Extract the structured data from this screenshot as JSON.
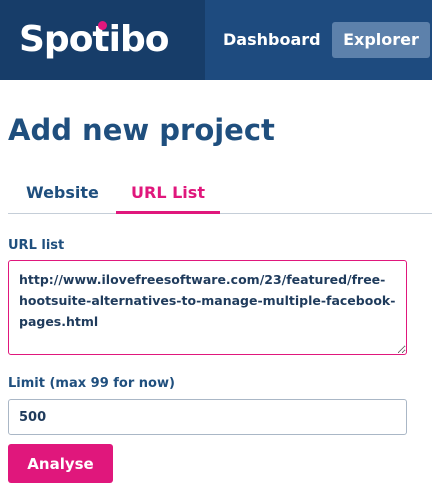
{
  "header": {
    "logo_text": "Spotibo",
    "nav": {
      "dashboard_label": "Dashboard",
      "explorer_label": "Explorer"
    }
  },
  "main": {
    "title": "Add new project",
    "tabs": [
      {
        "label": "Website",
        "active": false
      },
      {
        "label": "URL List",
        "active": true
      }
    ],
    "url_list": {
      "label": "URL list",
      "value": "http://www.ilovefreesoftware.com/23/featured/free-hootsuite-alternatives-to-manage-multiple-facebook-pages.html"
    },
    "limit": {
      "label": "Limit (max 99 for now)",
      "value": "500"
    },
    "analyse_button_label": "Analyse"
  },
  "colors": {
    "header_bg": "#1e4b7f",
    "logo_bg": "#173d69",
    "accent": "#e0177c",
    "explorer_bg": "#5d81ab",
    "title_text": "#1f4f7e"
  }
}
